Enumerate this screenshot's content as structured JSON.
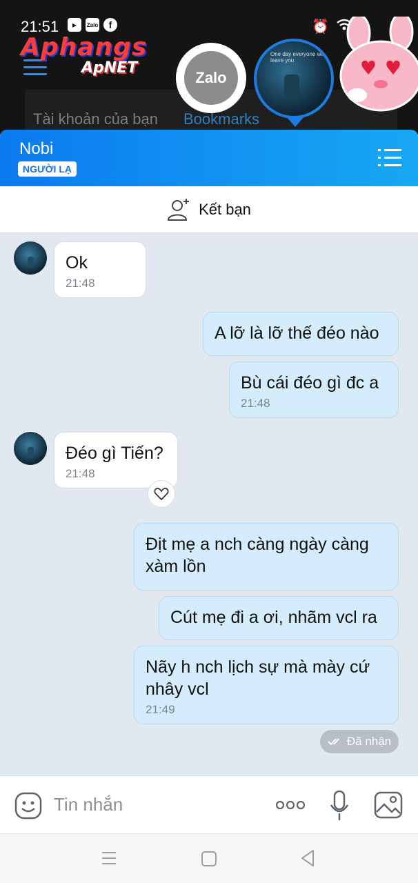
{
  "status_bar": {
    "time": "21:51"
  },
  "background_app": {
    "watermark_line1": "Aphangs",
    "watermark_line2": "ApNET",
    "tabs": [
      "Tài khoản của bạn",
      "Bookmarks"
    ]
  },
  "chathead": {
    "zalo_logo": "Zalo",
    "avatar_caption": "One day everyone will leave you"
  },
  "chat_header": {
    "contact_name": "Nobi",
    "badge": "NGƯỜI LẠ",
    "menu_icon": "list-menu-icon"
  },
  "add_friend": {
    "label": "Kết bạn",
    "icon": "add-user-icon"
  },
  "messages": [
    {
      "side": "incoming",
      "text": "Ok",
      "time": "21:48"
    },
    {
      "side": "outgoing",
      "text": "A lỡ là lỡ thế đéo nào",
      "time": ""
    },
    {
      "side": "outgoing",
      "text": "Bù cái đéo gì đc a",
      "time": "21:48"
    },
    {
      "side": "incoming",
      "text": "Đéo gì Tiến?",
      "time": "21:48",
      "reaction_icon": "heart-icon"
    },
    {
      "side": "outgoing",
      "text_lines": [
        "Địt mẹ a nch càng ngày càng",
        "xàm lồn"
      ],
      "time": ""
    },
    {
      "side": "outgoing",
      "text": "Cút mẹ đi a ơi, nhãm vcl ra",
      "time": ""
    },
    {
      "side": "outgoing",
      "text_lines": [
        "Nãy h nch lịch sự mà mày cứ",
        "nhây vcl"
      ],
      "time": "21:49"
    }
  ],
  "delivery_status": "Đã nhận",
  "input_bar": {
    "placeholder": "Tin nhắn",
    "icons": [
      "emoji-icon",
      "more-icon",
      "microphone-icon",
      "image-icon"
    ]
  },
  "colors": {
    "header_gradient_start": "#0b7af0",
    "header_gradient_end": "#17a8f4",
    "outgoing_bubble": "#d4ecfb",
    "chat_background": "#e2e8f0"
  }
}
